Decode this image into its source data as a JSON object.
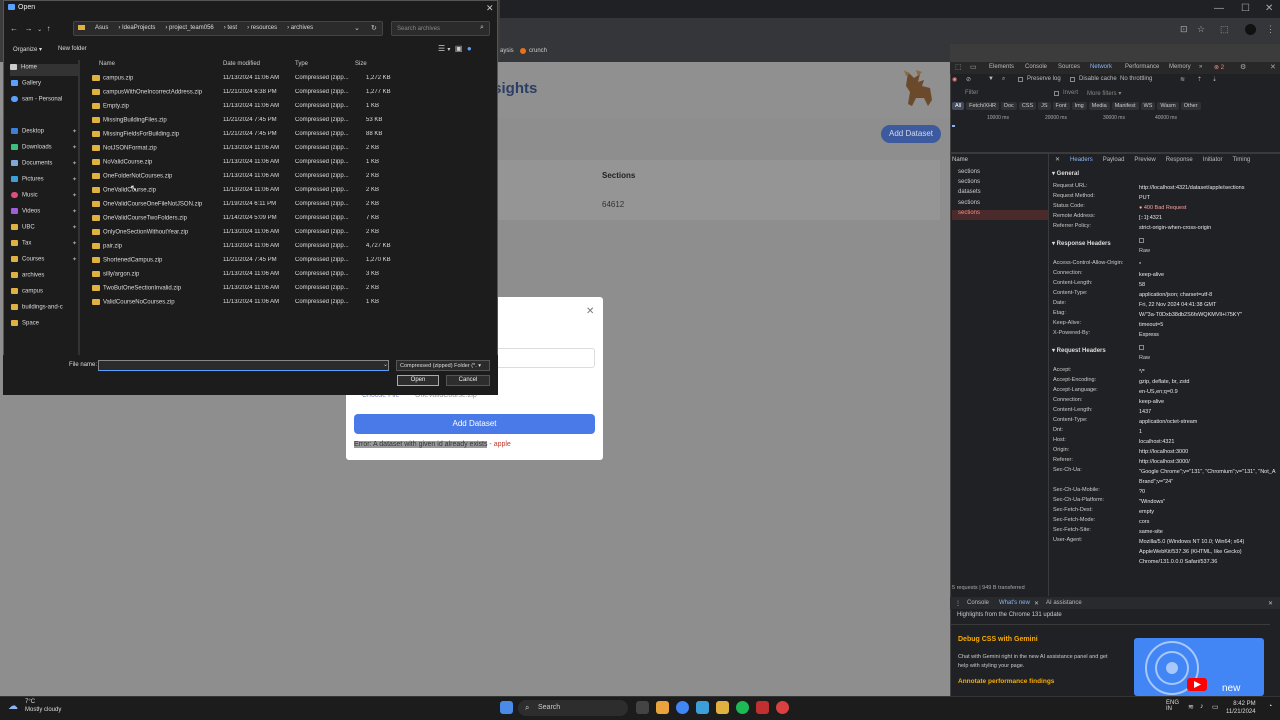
{
  "dialog": {
    "title": "Open",
    "breadcrumb": [
      "Asus",
      "IdeaProjects",
      "project_team056",
      "test",
      "resources",
      "archives"
    ],
    "search_placeholder": "Search archives",
    "organize": "Organize ▾",
    "new_folder": "New folder",
    "sidebar": [
      {
        "label": "Home",
        "pin": false
      },
      {
        "label": "Gallery",
        "pin": false
      },
      {
        "label": "sam - Personal",
        "pin": false
      },
      {
        "label": "Desktop",
        "pin": true
      },
      {
        "label": "Downloads",
        "pin": true
      },
      {
        "label": "Documents",
        "pin": true
      },
      {
        "label": "Pictures",
        "pin": true
      },
      {
        "label": "Music",
        "pin": true
      },
      {
        "label": "Videos",
        "pin": true
      },
      {
        "label": "UBC",
        "pin": true
      },
      {
        "label": "Tax",
        "pin": true
      },
      {
        "label": "Courses",
        "pin": true
      },
      {
        "label": "archives",
        "pin": false
      },
      {
        "label": "campus",
        "pin": false
      },
      {
        "label": "buildings-and-c",
        "pin": false
      },
      {
        "label": "Space",
        "pin": false
      }
    ],
    "columns": {
      "name": "Name",
      "date": "Date modified",
      "type": "Type",
      "size": "Size"
    },
    "files": [
      {
        "name": "campus.zip",
        "date": "11/13/2024 11:06 AM",
        "type": "Compressed (zipp...",
        "size": "1,272 KB"
      },
      {
        "name": "campusWithOneIncorrectAddress.zip",
        "date": "11/21/2024 6:38 PM",
        "type": "Compressed (zipp...",
        "size": "1,277 KB"
      },
      {
        "name": "Empty.zip",
        "date": "11/13/2024 11:06 AM",
        "type": "Compressed (zipp...",
        "size": "1 KB"
      },
      {
        "name": "MissingBuildingFiles.zip",
        "date": "11/21/2024 7:45 PM",
        "type": "Compressed (zipp...",
        "size": "53 KB"
      },
      {
        "name": "MissingFieldsForBuilding.zip",
        "date": "11/21/2024 7:45 PM",
        "type": "Compressed (zipp...",
        "size": "88 KB"
      },
      {
        "name": "NotJSONFormat.zip",
        "date": "11/13/2024 11:06 AM",
        "type": "Compressed (zipp...",
        "size": "2 KB"
      },
      {
        "name": "NoValidCourse.zip",
        "date": "11/13/2024 11:06 AM",
        "type": "Compressed (zipp...",
        "size": "1 KB"
      },
      {
        "name": "OneFolderNotCourses.zip",
        "date": "11/13/2024 11:06 AM",
        "type": "Compressed (zipp...",
        "size": "2 KB"
      },
      {
        "name": "OneValidCourse.zip",
        "date": "11/13/2024 11:06 AM",
        "type": "Compressed (zipp...",
        "size": "2 KB"
      },
      {
        "name": "OneValidCourseOneFileNotJSON.zip",
        "date": "11/19/2024 6:11 PM",
        "type": "Compressed (zipp...",
        "size": "2 KB"
      },
      {
        "name": "OneValidCourseTwoFolders.zip",
        "date": "11/14/2024 5:09 PM",
        "type": "Compressed (zipp...",
        "size": "7 KB"
      },
      {
        "name": "OnlyOneSectionWithoutYear.zip",
        "date": "11/13/2024 11:06 AM",
        "type": "Compressed (zipp...",
        "size": "2 KB"
      },
      {
        "name": "pair.zip",
        "date": "11/13/2024 11:06 AM",
        "type": "Compressed (zipp...",
        "size": "4,727 KB"
      },
      {
        "name": "ShortenedCampus.zip",
        "date": "11/21/2024 7:45 PM",
        "type": "Compressed (zipp...",
        "size": "1,270 KB"
      },
      {
        "name": "silly/argon.zip",
        "date": "11/13/2024 11:06 AM",
        "type": "Compressed (zipp...",
        "size": "3 KB"
      },
      {
        "name": "TwoButOneSectionInvalid.zip",
        "date": "11/13/2024 11:06 AM",
        "type": "Compressed (zipp...",
        "size": "2 KB"
      },
      {
        "name": "ValidCourseNoCourses.zip",
        "date": "11/13/2024 11:06 AM",
        "type": "Compressed (zipp...",
        "size": "1 KB"
      }
    ],
    "file_name_label": "File name:",
    "file_name_value": "",
    "file_type": "Compressed (zipped) Folder (*. ▾",
    "open": "Open",
    "cancel": "Cancel"
  },
  "browser": {
    "bookmark_items": [
      "aysis",
      "crunch"
    ]
  },
  "app": {
    "title": "nsights",
    "top_add_button": "Add Dataset",
    "sections_header": "Sections",
    "sections_value": "64612",
    "modal": {
      "close": "✕",
      "choose_file": "Choose File",
      "file_status": "OneValidCourse.zip",
      "add_button": "Add Dataset",
      "error_prefix": "Error: A dataset with given id already exists",
      "error_id": " - apple"
    }
  },
  "devtools": {
    "tabs": [
      "Elements",
      "Console",
      "Sources",
      "Network",
      "Performance",
      "Memory",
      "»"
    ],
    "selected_tab": "Network",
    "toolbar": {
      "preserve_log": "Preserve log",
      "disable_cache": "Disable cache",
      "throttling": "No throttling"
    },
    "filter_placeholder": "Filter",
    "invert": "Invert",
    "more_filters": "More filters ▾",
    "type_filters": [
      "All",
      "Fetch/XHR",
      "Doc",
      "CSS",
      "JS",
      "Font",
      "Img",
      "Media",
      "Manifest",
      "WS",
      "Wasm",
      "Other"
    ],
    "timeline_labels": [
      "10000 ms",
      "20000 ms",
      "30000 ms",
      "40000 ms"
    ],
    "name_header": "Name",
    "requests": [
      {
        "name": "sections",
        "error": false
      },
      {
        "name": "sections",
        "error": false
      },
      {
        "name": "datasets",
        "error": false
      },
      {
        "name": "sections",
        "error": false
      },
      {
        "name": "sections",
        "error": true
      }
    ],
    "header_tabs": [
      "Headers",
      "Payload",
      "Preview",
      "Response",
      "Initiator",
      "Timing"
    ],
    "general_title": "▾ General",
    "general": [
      {
        "k": "Request URL:",
        "v": "http://localhost:4321/dataset/apple/sections"
      },
      {
        "k": "Request Method:",
        "v": "PUT"
      },
      {
        "k": "Status Code:",
        "v": "● 400 Bad Request"
      },
      {
        "k": "Remote Address:",
        "v": "[::1]:4321"
      },
      {
        "k": "Referrer Policy:",
        "v": "strict-origin-when-cross-origin"
      }
    ],
    "response_title": "▾ Response Headers",
    "raw": "Raw",
    "response_headers": [
      {
        "k": "Access-Control-Allow-Origin:",
        "v": "*"
      },
      {
        "k": "Connection:",
        "v": "keep-alive"
      },
      {
        "k": "Content-Length:",
        "v": "58"
      },
      {
        "k": "Content-Type:",
        "v": "application/json; charset=utf-8"
      },
      {
        "k": "Date:",
        "v": "Fri, 22 Nov 2024 04:41:38 GMT"
      },
      {
        "k": "Etag:",
        "v": "W/\"3a-T0Dxb38db2S6fsWQKMVll+I75KY\""
      },
      {
        "k": "Keep-Alive:",
        "v": "timeout=5"
      },
      {
        "k": "X-Powered-By:",
        "v": "Express"
      }
    ],
    "request_title": "▾ Request Headers",
    "request_headers": [
      {
        "k": "Accept:",
        "v": "*/*"
      },
      {
        "k": "Accept-Encoding:",
        "v": "gzip, deflate, br, zstd"
      },
      {
        "k": "Accept-Language:",
        "v": "en-US,en;q=0.9"
      },
      {
        "k": "Connection:",
        "v": "keep-alive"
      },
      {
        "k": "Content-Length:",
        "v": "1437"
      },
      {
        "k": "Content-Type:",
        "v": "application/octet-stream"
      },
      {
        "k": "Dnt:",
        "v": "1"
      },
      {
        "k": "Host:",
        "v": "localhost:4321"
      },
      {
        "k": "Origin:",
        "v": "http://localhost:3000"
      },
      {
        "k": "Referer:",
        "v": "http://localhost:3000/"
      },
      {
        "k": "Sec-Ch-Ua:",
        "v": "\"Google Chrome\";v=\"131\", \"Chromium\";v=\"131\", \"Not_A Brand\";v=\"24\""
      },
      {
        "k": "Sec-Ch-Ua-Mobile:",
        "v": "?0"
      },
      {
        "k": "Sec-Ch-Ua-Platform:",
        "v": "\"Windows\""
      },
      {
        "k": "Sec-Fetch-Dest:",
        "v": "empty"
      },
      {
        "k": "Sec-Fetch-Mode:",
        "v": "cors"
      },
      {
        "k": "Sec-Fetch-Site:",
        "v": "same-site"
      },
      {
        "k": "User-Agent:",
        "v": "Mozilla/5.0 (Windows NT 10.0; Win64; x64) AppleWebKit/537.36 (KHTML, like Gecko) Chrome/131.0.0.0 Safari/537.36"
      }
    ],
    "footer": "5 requests  |  949 B transferred",
    "drawer_tabs": [
      "Console",
      "What's new",
      "AI assistance"
    ],
    "drawer_highlight": "Highlights from the Chrome 131 update",
    "gemini_title": "Debug CSS with Gemini",
    "gemini_desc": "Chat with Gemini right in the new AI assistance panel and get help with styling your page.",
    "annotate": "Annotate performance findings",
    "promo_new": "new"
  },
  "taskbar": {
    "temp": "7°C",
    "weather": "Mostly cloudy",
    "search": "Search",
    "lang": "ENG",
    "region": "IN",
    "time": "8:42 PM",
    "date": "11/21/2024"
  },
  "colors": {
    "accent": "#4a7ae8",
    "error": "#c0392b",
    "folder": "#e0b040",
    "devtools_link": "#8ab4f8"
  }
}
